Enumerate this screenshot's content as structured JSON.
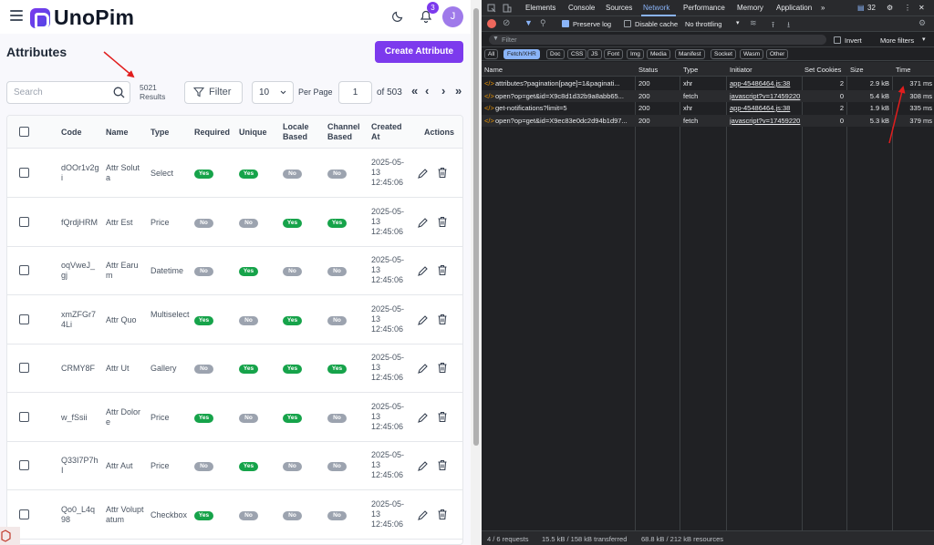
{
  "app": {
    "logo_text": "UnoPim",
    "notification_count": "3",
    "avatar_initial": "J",
    "page_title": "Attributes",
    "create_button": "Create Attribute",
    "search_placeholder": "Search",
    "results_count": "5021",
    "results_label": "Results",
    "filter_label": "Filter",
    "per_page_value": "10",
    "per_page_label": "Per Page",
    "current_page": "1",
    "total_pages_label": "of 503",
    "columns": [
      "Code",
      "Name",
      "Type",
      "Required",
      "Unique",
      "Locale Based",
      "Channel Based",
      "Created At",
      "Actions"
    ],
    "rows": [
      {
        "code": "dOOr1v2gi",
        "name": "Attr Soluta",
        "type": "Select",
        "required": "Yes",
        "unique": "Yes",
        "locale": "No",
        "channel": "No",
        "created": "2025-05-13 12:45:06"
      },
      {
        "code": "fQrdjHRM",
        "name": "Attr Est",
        "type": "Price",
        "required": "No",
        "unique": "No",
        "locale": "Yes",
        "channel": "Yes",
        "created": "2025-05-13 12:45:06"
      },
      {
        "code": "oqVweJ_gj",
        "name": "Attr Earum",
        "type": "Datetime",
        "required": "No",
        "unique": "Yes",
        "locale": "No",
        "channel": "No",
        "created": "2025-05-13 12:45:06"
      },
      {
        "code": "xmZFGr74Li",
        "name": "Attr Quo",
        "type": "Multiselect",
        "required": "Yes",
        "unique": "No",
        "locale": "Yes",
        "channel": "No",
        "created": "2025-05-13 12:45:06"
      },
      {
        "code": "CRMY8F",
        "name": "Attr Ut",
        "type": "Gallery",
        "required": "No",
        "unique": "Yes",
        "locale": "Yes",
        "channel": "Yes",
        "created": "2025-05-13 12:45:06"
      },
      {
        "code": "w_fSsii",
        "name": "Attr Dolore",
        "type": "Price",
        "required": "Yes",
        "unique": "No",
        "locale": "Yes",
        "channel": "No",
        "created": "2025-05-13 12:45:06"
      },
      {
        "code": "Q33I7P7hI",
        "name": "Attr Aut",
        "type": "Price",
        "required": "No",
        "unique": "Yes",
        "locale": "No",
        "channel": "No",
        "created": "2025-05-13 12:45:06"
      },
      {
        "code": "Qo0_L4q98",
        "name": "Attr Voluptatum",
        "type": "Checkbox",
        "required": "Yes",
        "unique": "No",
        "locale": "No",
        "channel": "No",
        "created": "2025-05-13 12:45:06"
      }
    ]
  },
  "devtools": {
    "tabs": [
      "Elements",
      "Console",
      "Sources",
      "Network",
      "Performance",
      "Memory",
      "Application"
    ],
    "active_tab": "Network",
    "issues_count": "32",
    "preserve_log": "Preserve log",
    "disable_cache": "Disable cache",
    "throttling": "No throttling",
    "filter_placeholder": "Filter",
    "invert": "Invert",
    "more_filters": "More filters",
    "types": [
      "All",
      "Fetch/XHR",
      "Doc",
      "CSS",
      "JS",
      "Font",
      "Img",
      "Media",
      "Manifest",
      "Socket",
      "Wasm",
      "Other"
    ],
    "columns": [
      "Name",
      "Status",
      "Type",
      "Initiator",
      "Set Cookies",
      "Size",
      "Time"
    ],
    "requests": [
      {
        "name": "attributes?pagination[page]=1&paginati...",
        "status": "200",
        "type": "xhr",
        "initiator": "app-45486464.js:38",
        "cookies": "2",
        "size": "2.9 kB",
        "time": "371 ms"
      },
      {
        "name": "open?op=get&id=X9c8d1d32b9a8abb65...",
        "status": "200",
        "type": "fetch",
        "initiator": "javascript?v=17459220",
        "cookies": "0",
        "size": "5.4 kB",
        "time": "308 ms"
      },
      {
        "name": "get-notifications?limit=5",
        "status": "200",
        "type": "xhr",
        "initiator": "app-45486464.js:38",
        "cookies": "2",
        "size": "1.9 kB",
        "time": "335 ms"
      },
      {
        "name": "open?op=get&id=X9ec83e0dc2d94b1d97...",
        "status": "200",
        "type": "fetch",
        "initiator": "javascript?v=17459220",
        "cookies": "0",
        "size": "5.3 kB",
        "time": "379 ms"
      }
    ],
    "status_requests": "4 / 6 requests",
    "status_transferred": "15.5 kB / 158 kB transferred",
    "status_resources": "68.8 kB / 212 kB resources"
  },
  "colors": {
    "accent": "#7c3aed",
    "yes": "#16a34a",
    "no": "#9ca3af",
    "annotation": "#e11d1d"
  }
}
